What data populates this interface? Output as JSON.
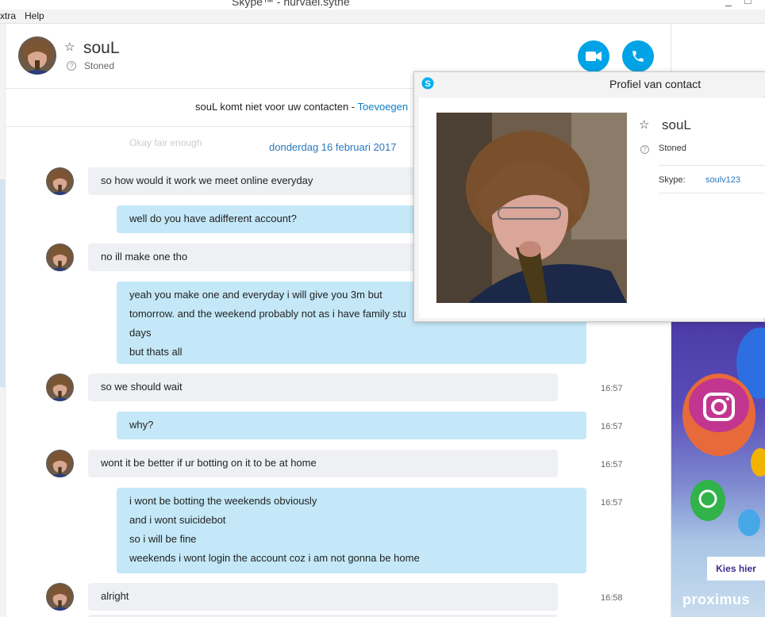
{
  "window": {
    "title": "Skype™ - hurvael.sythe",
    "menu": [
      "xtra",
      "Help"
    ]
  },
  "contact": {
    "name": "souL",
    "status": "Stoned",
    "avatar_icon": "user-photo"
  },
  "header_actions": {
    "video_icon": "video-camera-icon",
    "call_icon": "phone-icon"
  },
  "notice": {
    "text": "souL komt niet voor uw contacten -",
    "link": "Toevoegen"
  },
  "chat": {
    "faded_text": "Okay fair enough",
    "date_separator": "donderdag 16 februari 2017",
    "messages": [
      {
        "side": "in",
        "lines": [
          "so how would it work  we meet online everyday"
        ],
        "time": ""
      },
      {
        "side": "out",
        "lines": [
          "well do you have  adifferent account?"
        ],
        "time": ""
      },
      {
        "side": "in",
        "lines": [
          "no ill make one tho"
        ],
        "time": ""
      },
      {
        "side": "out",
        "lines": [
          "yeah you make one and everyday i will give you 3m but",
          "tomorrow. and the weekend probably not as i have family stu",
          "days",
          "but thats all"
        ],
        "time": ""
      },
      {
        "side": "in",
        "lines": [
          "so we should wait"
        ],
        "time": "16:57"
      },
      {
        "side": "out",
        "lines": [
          "why?"
        ],
        "time": "16:57"
      },
      {
        "side": "in",
        "lines": [
          "wont it be better if ur botting on it to be at home"
        ],
        "time": "16:57"
      },
      {
        "side": "out",
        "lines": [
          "i wont be botting the weekends obviously",
          "and i wont suicidebot",
          "so i will be fine",
          "weekends i wont login the account coz i am not gonna be home"
        ],
        "time": "16:57"
      },
      {
        "side": "in",
        "lines": [
          "alright"
        ],
        "time": "16:58"
      }
    ]
  },
  "profile_popup": {
    "title": "Profiel van contact",
    "name": "souL",
    "status": "Stoned",
    "skype_label": "Skype:",
    "skype_id": "soulv123"
  },
  "ad": {
    "cta": "Kies hier",
    "brand": "proximus",
    "colors": {
      "top": "#4b3aa6",
      "bottom": "#c9dcee"
    }
  },
  "colors": {
    "accent": "#00a3e6",
    "outgoing_bubble": "#c4e8f8",
    "incoming_bubble": "#eef0f3",
    "link": "#2a79bd"
  }
}
